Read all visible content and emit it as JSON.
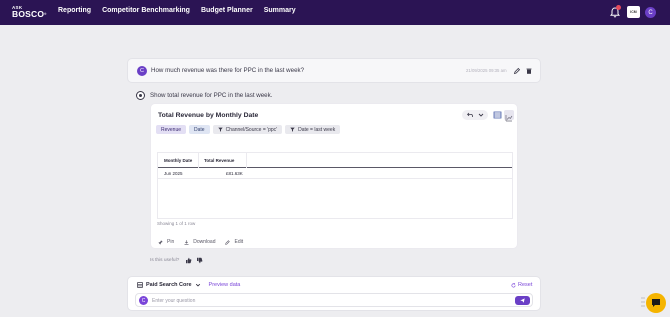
{
  "brand": {
    "line1": "ASK",
    "line2": "BOSCO",
    "reg": "®"
  },
  "nav": {
    "items": [
      {
        "label": "Reporting"
      },
      {
        "label": "Competitor Benchmarking"
      },
      {
        "label": "Budget Planner"
      },
      {
        "label": "Summary"
      }
    ]
  },
  "header": {
    "notification_count": "",
    "org_logo_text": "ICM",
    "user_initial": "C"
  },
  "question": {
    "avatar_initial": "C",
    "text": "How much revenue was there for PPC in the last week?",
    "timestamp": "21/09/2025 09:35 am"
  },
  "answer": {
    "text": "Show total revenue for PPC in the last week.",
    "card": {
      "title": "Total Revenue by Monthly Date",
      "chips": [
        {
          "type": "metric",
          "label": "Revenue"
        },
        {
          "type": "dim",
          "label": "Date"
        },
        {
          "type": "filter",
          "label": "Channel/Source = 'ppc'"
        },
        {
          "type": "filter",
          "label": "Date = last week"
        }
      ],
      "table": {
        "columns": [
          "Monthly Date",
          "Total Revenue"
        ],
        "rows": [
          [
            "Jun 2025",
            "£81.63K"
          ]
        ]
      },
      "showing": "Showing 1 of 1 row",
      "actions": {
        "pin": "Pin",
        "download": "Download",
        "edit": "Edit"
      }
    },
    "feedback_prompt": "Is this useful?"
  },
  "composer": {
    "source": "Paid Search Core",
    "preview": "Preview data",
    "reset": "Reset",
    "avatar_initial": "C",
    "placeholder": "Enter your question"
  },
  "colors": {
    "nav_bg": "#2b1454",
    "accent": "#6a3fc6",
    "help_fab": "#f5b400"
  }
}
